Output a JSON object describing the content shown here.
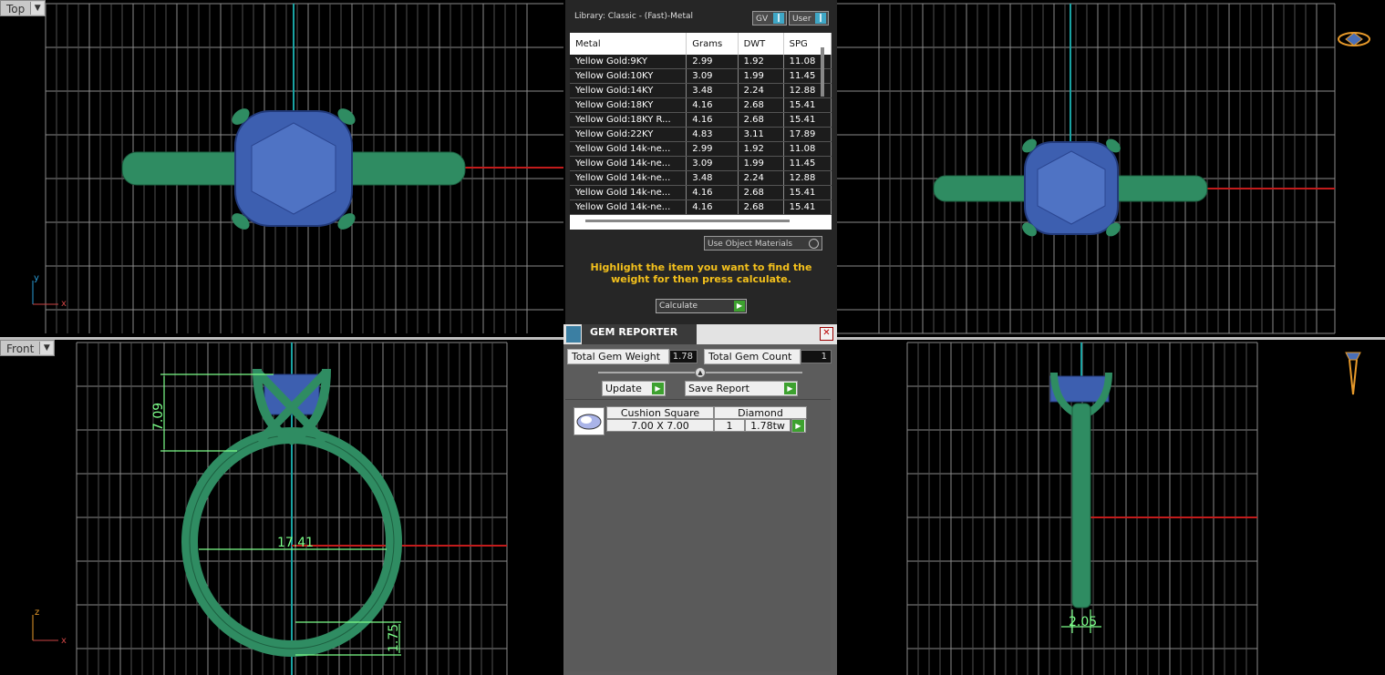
{
  "viewports": {
    "top_left_label": "Top",
    "front_label": "Front",
    "axis_y": "y",
    "axis_x": "x",
    "axis_z": "z"
  },
  "dimensions": {
    "height_label": "7.09",
    "inner_label": "17.41",
    "bottom_label": "1.75",
    "side_label": "2.05"
  },
  "library": {
    "title": "Library: Classic - (Fast)-Metal",
    "gv_label": "GV",
    "user_label": "User",
    "columns": [
      "Metal",
      "Grams",
      "DWT",
      "SPG"
    ],
    "rows": [
      [
        "Yellow Gold:9KY",
        "2.99",
        "1.92",
        "11.08"
      ],
      [
        "Yellow Gold:10KY",
        "3.09",
        "1.99",
        "11.45"
      ],
      [
        "Yellow Gold:14KY",
        "3.48",
        "2.24",
        "12.88"
      ],
      [
        "Yellow Gold:18KY",
        "4.16",
        "2.68",
        "15.41"
      ],
      [
        "Yellow Gold:18KY R...",
        "4.16",
        "2.68",
        "15.41"
      ],
      [
        "Yellow Gold:22KY",
        "4.83",
        "3.11",
        "17.89"
      ],
      [
        "Yellow Gold 14k-ne...",
        "2.99",
        "1.92",
        "11.08"
      ],
      [
        "Yellow Gold 14k-ne...",
        "3.09",
        "1.99",
        "11.45"
      ],
      [
        "Yellow Gold 14k-ne...",
        "3.48",
        "2.24",
        "12.88"
      ],
      [
        "Yellow Gold 14k-ne...",
        "4.16",
        "2.68",
        "15.41"
      ],
      [
        "Yellow Gold 14k-ne...",
        "4.16",
        "2.68",
        "15.41"
      ]
    ],
    "use_object_materials": "Use Object Materials",
    "hint": "Highlight the item you want to find the weight for then press calculate.",
    "calculate_label": "Calculate"
  },
  "gem_reporter": {
    "title": "GEM REPORTER",
    "total_weight_label": "Total Gem Weight",
    "total_weight_value": "1.78",
    "total_count_label": "Total Gem Count",
    "total_count_value": "1",
    "update_label": "Update",
    "save_report_label": "Save Report",
    "gem": {
      "cut": "Cushion Square",
      "type": "Diamond",
      "size": "7.00 X 7.00",
      "count": "1",
      "weight": "1.78tw"
    }
  },
  "colors": {
    "ring_metal": "#2f8c62",
    "gem_blue": "#3d5fb0",
    "grid": "#9a9a9a",
    "accent_green": "#3da12f",
    "hint_yellow": "#f3c01c"
  }
}
